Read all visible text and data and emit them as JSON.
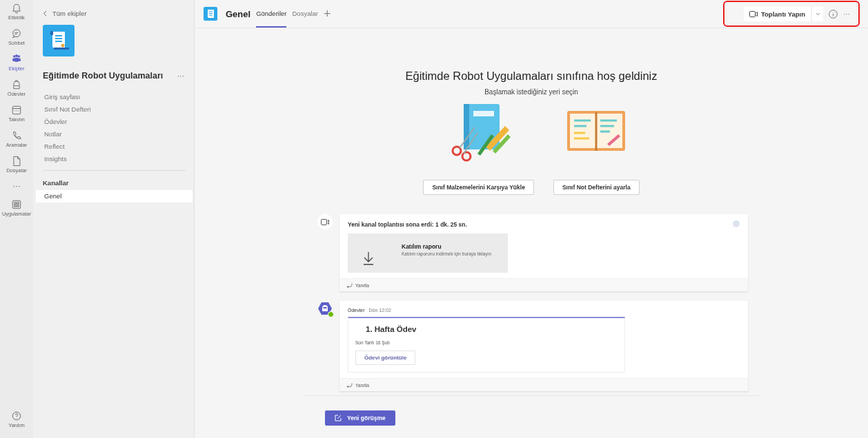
{
  "rail": {
    "items": [
      {
        "label": "Etkinlik",
        "selected": false
      },
      {
        "label": "Sohbet",
        "selected": false
      },
      {
        "label": "Ekipler",
        "selected": true
      },
      {
        "label": "Ödevler",
        "selected": false
      },
      {
        "label": "Takvim",
        "selected": false
      },
      {
        "label": "Aramalar",
        "selected": false
      },
      {
        "label": "Dosyalar",
        "selected": false
      }
    ],
    "more": "···",
    "apps": "Uygulamalar",
    "help": "Yardım"
  },
  "team_panel": {
    "back_link": "Tüm ekipler",
    "team_name": "Eğitimde Robot Uygulamaları",
    "team_menu": "···",
    "nav": [
      {
        "label": "Giriş sayfası",
        "selected": false
      },
      {
        "label": "Sınıf Not Defteri",
        "selected": false
      },
      {
        "label": "Ödevler",
        "selected": false
      },
      {
        "label": "Notlar",
        "selected": false
      },
      {
        "label": "Reflect",
        "selected": false
      },
      {
        "label": "Insights",
        "selected": false
      }
    ],
    "channels_heading": "Kanallar",
    "channels": [
      {
        "name": "Genel",
        "selected": true
      }
    ]
  },
  "header": {
    "channel": "Genel",
    "tabs": [
      {
        "label": "Gönderiler",
        "selected": true
      },
      {
        "label": "Dosyalar",
        "selected": false
      }
    ],
    "add_tab": "+",
    "meet_button": "Toplantı Yapın",
    "more": "···"
  },
  "welcome": {
    "title": "Eğitimde Robot Uygulamaları sınıfına hoş geldiniz",
    "subtitle": "Başlamak istediğiniz yeri seçin",
    "actions": [
      "Sınıf Malzemelerini Karşıya Yükle",
      "Sınıf Not Defterini ayarla"
    ]
  },
  "messages": [
    {
      "text": "Yeni kanal toplantısı sona erdi: 1 dk. 25 sn.",
      "attachment_title": "Katılım raporu",
      "attachment_desc": "Katılım raporunu indirmek için buraya tıklayın",
      "reply": "Yanıtla"
    },
    {
      "sender": "Ödevler",
      "time": "Dün 12:02",
      "online": true,
      "card_title": "1. Hafta Ödev",
      "due": "Son Tarih 16 Şub",
      "card_button": "Ödevi görüntüle",
      "reply": "Yanıtla"
    }
  ],
  "new_conversation": "Yeni görüşme"
}
